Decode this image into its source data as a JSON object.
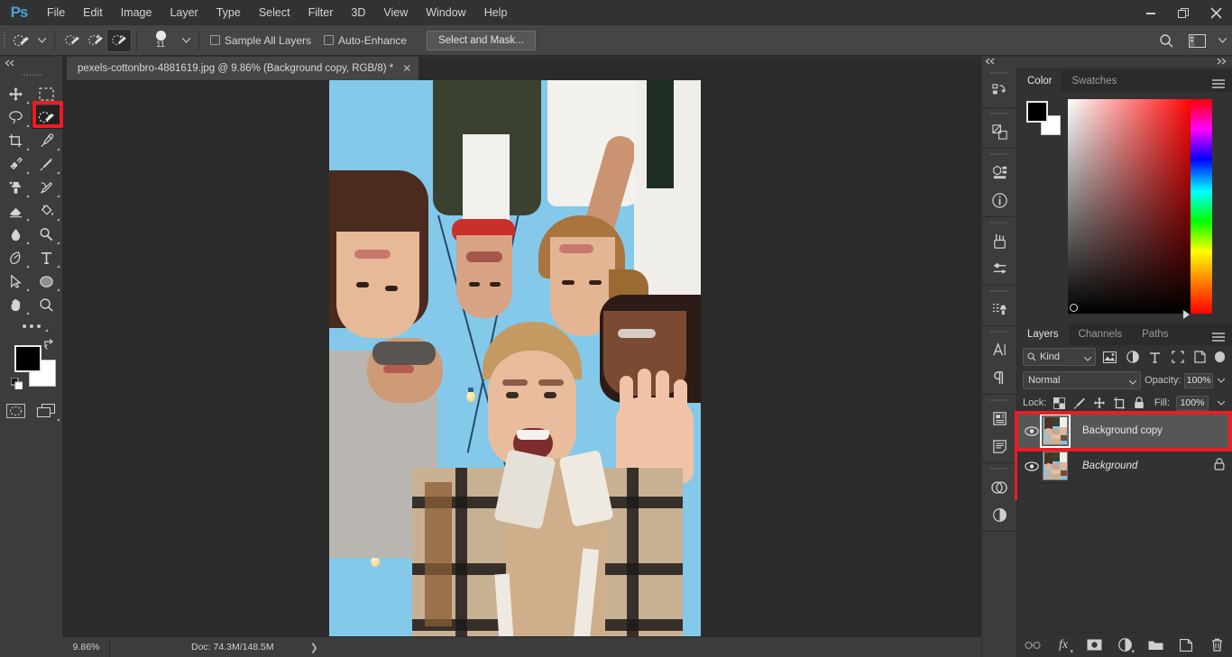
{
  "app": {
    "name": "Adobe Photoshop",
    "logo": "Ps"
  },
  "menubar": {
    "items": [
      "File",
      "Edit",
      "Image",
      "Layer",
      "Type",
      "Select",
      "Filter",
      "3D",
      "View",
      "Window",
      "Help"
    ]
  },
  "window_controls": {
    "minimize": "minimize-icon",
    "restore": "restore-icon",
    "close": "close-icon"
  },
  "options_bar": {
    "tool_preset": "quick-selection-tool-icon",
    "modes": [
      {
        "name": "new-selection",
        "active": false
      },
      {
        "name": "add-to-selection",
        "active": false
      },
      {
        "name": "subtract-from-selection",
        "active": true
      }
    ],
    "brush_size": "11",
    "sample_all_layers": {
      "label": "Sample All Layers",
      "checked": false
    },
    "auto_enhance": {
      "label": "Auto-Enhance",
      "checked": false
    },
    "select_and_mask": "Select and Mask...",
    "search_icon": "search-icon",
    "workspace_icon": "workspace-icon"
  },
  "toolbar": {
    "tools": [
      {
        "name": "move-tool",
        "icon": "move"
      },
      {
        "name": "rectangular-marquee-tool",
        "icon": "marquee"
      },
      {
        "name": "lasso-tool",
        "icon": "lasso"
      },
      {
        "name": "quick-selection-tool",
        "icon": "quickselect",
        "selected": true
      },
      {
        "name": "crop-tool",
        "icon": "crop"
      },
      {
        "name": "eyedropper-tool",
        "icon": "eyedropper"
      },
      {
        "name": "spot-healing-brush-tool",
        "icon": "healing"
      },
      {
        "name": "brush-tool",
        "icon": "brush"
      },
      {
        "name": "clone-stamp-tool",
        "icon": "stamp"
      },
      {
        "name": "history-brush-tool",
        "icon": "historybrush"
      },
      {
        "name": "eraser-tool",
        "icon": "eraser"
      },
      {
        "name": "gradient-tool",
        "icon": "paintbucket"
      },
      {
        "name": "blur-tool",
        "icon": "blur"
      },
      {
        "name": "dodge-tool",
        "icon": "dodge"
      },
      {
        "name": "pen-tool",
        "icon": "pen"
      },
      {
        "name": "horizontal-type-tool",
        "icon": "type"
      },
      {
        "name": "path-selection-tool",
        "icon": "pathselect"
      },
      {
        "name": "ellipse-tool",
        "icon": "ellipse"
      },
      {
        "name": "hand-tool",
        "icon": "hand"
      },
      {
        "name": "zoom-tool",
        "icon": "zoom"
      }
    ],
    "edit_toolbar": "more-tools-icon",
    "foreground_color": "#000000",
    "background_color": "#ffffff",
    "swap_colors_icon": "swap-colors-icon",
    "default_colors_icon": "default-colors-icon",
    "quick_mask_icon": "quick-mask-icon",
    "screen_mode_icon": "screen-mode-icon",
    "highlight_color": "#ee1b24"
  },
  "document": {
    "tab_title": "pexels-cottonbro-4881619.jpg @ 9.86% (Background copy, RGB/8) *",
    "close_icon": "close-icon"
  },
  "status_bar": {
    "zoom": "9.86%",
    "doc_info": "Doc: 74.3M/148.5M",
    "expand_icon": "chevron-right-icon"
  },
  "rail": {
    "icons": [
      "history-icon",
      "brush-settings-icon",
      "3d-icon",
      "info-icon",
      "brushes-icon",
      "adjustments-icon",
      "clone-source-icon",
      "character-icon",
      "paragraph-icon",
      "libraries-icon",
      "notes-icon",
      "layers-comp-icon",
      "adjustment-layer-icon"
    ],
    "highlight_color": "#ee1b24"
  },
  "panels": {
    "collapse_left_icon": "collapse-panels-icon",
    "expand_right_icon": "expand-panels-icon",
    "color": {
      "tabs": [
        {
          "label": "Color",
          "active": true
        },
        {
          "label": "Swatches",
          "active": false
        }
      ],
      "menu_icon": "panel-menu-icon",
      "foreground": "#000000",
      "background": "#ffffff",
      "spectrum_base": "#ff0000"
    },
    "layers": {
      "tabs": [
        {
          "label": "Layers",
          "active": true
        },
        {
          "label": "Channels",
          "active": false
        },
        {
          "label": "Paths",
          "active": false
        }
      ],
      "menu_icon": "panel-menu-icon",
      "filter": {
        "kind_label": "Kind",
        "search_icon": "search-icon",
        "chevron_icon": "chevron-down-icon",
        "filter_icons": [
          "pixel-filter-icon",
          "adjustment-filter-icon",
          "type-filter-icon",
          "shape-filter-icon",
          "smart-object-filter-icon"
        ],
        "toggle_icon": "filter-toggle-icon"
      },
      "blend_mode": "Normal",
      "opacity_label": "Opacity:",
      "opacity_value": "100%",
      "lock_label": "Lock:",
      "lock_icons": [
        "lock-transparent-pixels-icon",
        "lock-image-pixels-icon",
        "lock-position-icon",
        "lock-artboard-icon",
        "lock-all-icon"
      ],
      "fill_label": "Fill:",
      "fill_value": "100%",
      "rows": [
        {
          "name": "Background copy",
          "visible": true,
          "selected": true,
          "locked": false,
          "italic": false,
          "thumb_framed": true
        },
        {
          "name": "Background",
          "visible": true,
          "selected": false,
          "locked": true,
          "italic": true,
          "thumb_framed": false
        }
      ],
      "highlight_color": "#ee1b24",
      "bottom_icons": [
        "link-layers-icon",
        "layer-style-icon",
        "layer-mask-icon",
        "new-fill-adjustment-icon",
        "new-group-icon",
        "new-layer-icon",
        "delete-layer-icon"
      ],
      "layer_style_label": "fx"
    }
  },
  "canvas": {
    "image_description": "Group of friends in a circle photographed from below, blue sky with string lights",
    "selection_active": true,
    "sky_color": "#84c9ea"
  }
}
